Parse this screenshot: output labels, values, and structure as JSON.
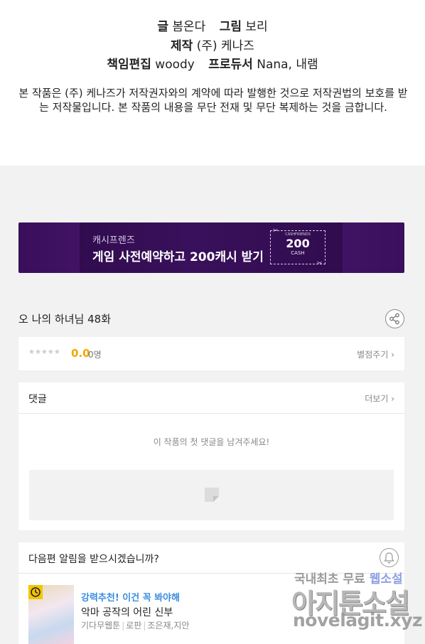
{
  "credits": {
    "writer_label": "글",
    "writer": "봄온다",
    "artist_label": "그림",
    "artist": "보리",
    "producer_label": "제작",
    "producer": "(주) 케나즈",
    "editor_label": "책임편집",
    "editor": "woody",
    "pd_label": "프로듀서",
    "pd": "Nana, 내램"
  },
  "notice": "본 작품은 (주) 케나즈가 저작권자와의 계약에 따라 발행한 것으로 저작권법의 보호를 받는 저작물입니다. 본 작품의 내용을 무단 전재 및 무단 복제하는 것을 금합니다.",
  "banner": {
    "subtitle": "캐시프렌즈",
    "title": "게임 사전예약하고 200캐시 받기",
    "coupon_tiny": "CASHFRIENDS",
    "coupon_amount": "200",
    "coupon_unit": "CASH",
    "colors": {
      "bg": "#3a0e5a",
      "text": "#ffffff"
    }
  },
  "episode": {
    "title": "오 나의 하녀님 48화",
    "share_icon": "share-icon"
  },
  "rating": {
    "stars": "★★★★★",
    "stars_filled": 0,
    "score": "0.0",
    "count": "0명",
    "action": "별점주기 ›"
  },
  "comments": {
    "title": "댓글",
    "more": "더보기 ›",
    "empty": "이 작품의 첫 댓글을 남겨주세요!"
  },
  "notify": {
    "question": "다음편 알림을 받으시겠습니까?",
    "bell_icon": "bell-icon"
  },
  "recommendation": {
    "tag": "강력추천! 이건 꼭 봐야해",
    "title": "악마 공작의 어린 신부",
    "genre": "기다무웹툰",
    "category": "로판",
    "authors": "조은재,지안"
  },
  "watermark": {
    "line1a": "국내최초 무료",
    "line1b": "웹소설",
    "line2": "아지툰소설",
    "line3": "novelagit.xyz"
  }
}
